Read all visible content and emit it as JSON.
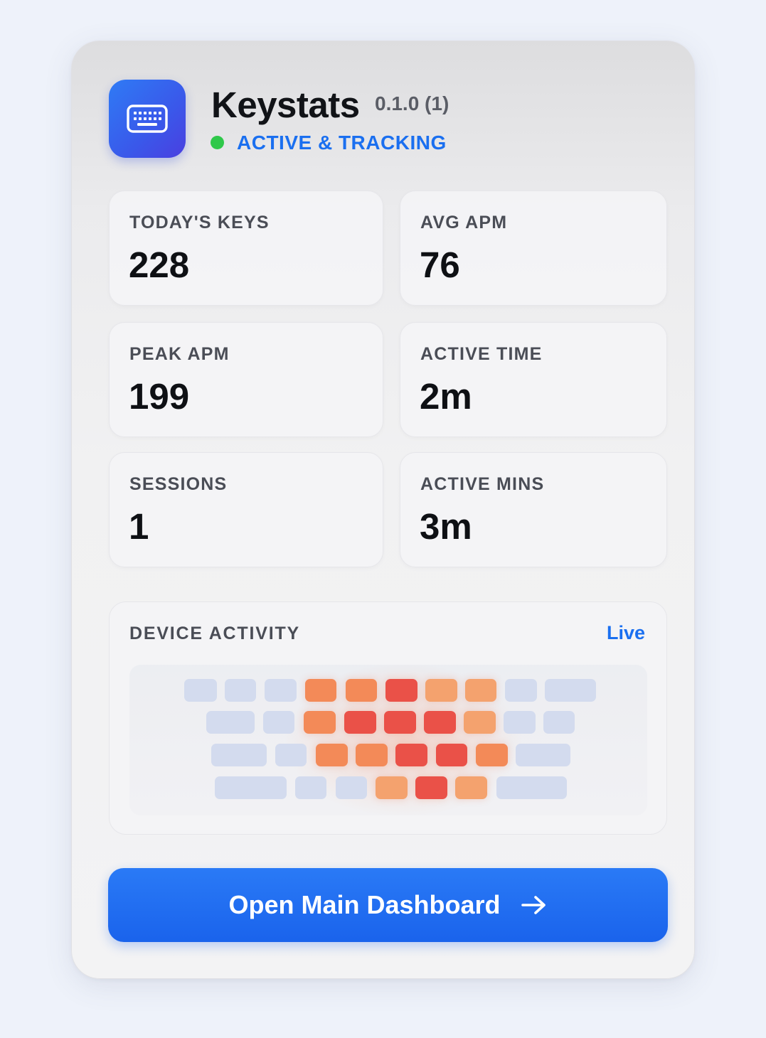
{
  "app": {
    "title": "Keystats",
    "version": "0.1.0 (1)",
    "status": "ACTIVE & TRACKING",
    "accent": "#1a6ff0",
    "status_color": "#2fc84a",
    "icon": "keyboard-icon"
  },
  "stats": [
    {
      "label": "TODAY'S KEYS",
      "value": "228"
    },
    {
      "label": "AVG APM",
      "value": "76"
    },
    {
      "label": "PEAK APM",
      "value": "199"
    },
    {
      "label": "ACTIVE TIME",
      "value": "2m"
    },
    {
      "label": "SESSIONS",
      "value": "1"
    },
    {
      "label": "ACTIVE MINS",
      "value": "3m"
    }
  ],
  "activity": {
    "title": "DEVICE ACTIVITY",
    "live_label": "Live",
    "heat_colors": {
      "none": "#d3dbee",
      "low": "#f4a26e",
      "mid": "#f38a58",
      "high": "#ea5148"
    },
    "rows": [
      [
        "none",
        "none",
        "none",
        "mid",
        "mid",
        "high",
        "low",
        "low",
        "none",
        "none"
      ],
      [
        "none",
        "none",
        "mid",
        "high",
        "high",
        "high",
        "low",
        "none",
        "none"
      ],
      [
        "none",
        "none",
        "mid",
        "mid",
        "high",
        "high",
        "mid",
        "none"
      ],
      [
        "none",
        "none",
        "none",
        "low",
        "high",
        "low",
        "none"
      ]
    ]
  },
  "cta": {
    "label": "Open Main Dashboard",
    "icon": "arrow-right-icon"
  }
}
